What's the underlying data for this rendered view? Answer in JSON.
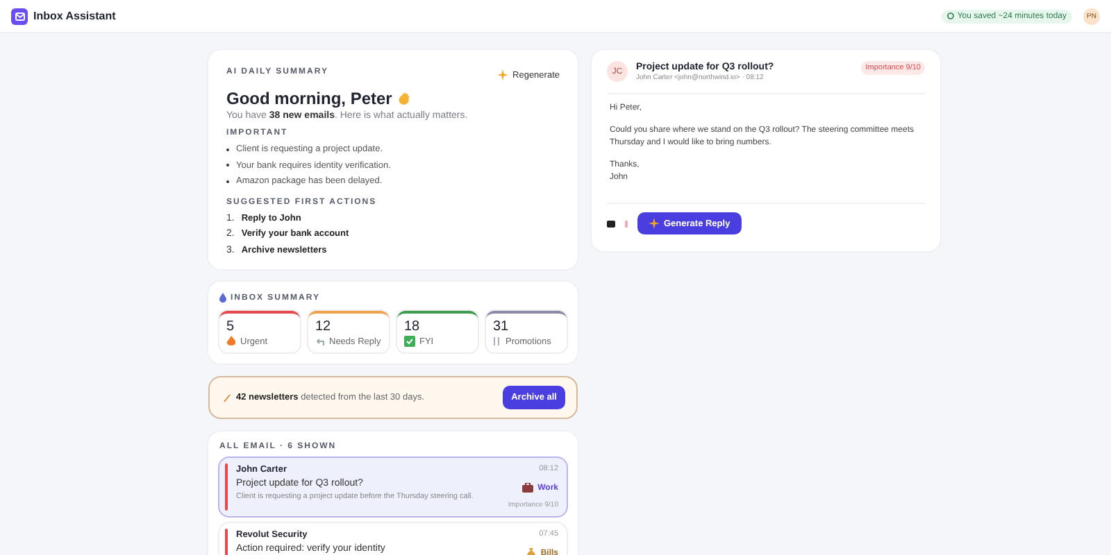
{
  "header": {
    "title": "Inbox Assistant",
    "saved_badge": "You saved ~24 minutes today",
    "avatar_initials": "PN"
  },
  "daily_summary": {
    "label": "AI DAILY SUMMARY",
    "regenerate_button": "Regenerate",
    "greeting": "Good morning, Peter",
    "subtitle": "You have **38 new emails**. Here is what actually matters.",
    "important_label": "IMPORTANT",
    "important": [
      "Client is requesting a project update.",
      "Your bank requires identity verification.",
      "Amazon package has been delayed."
    ],
    "actions_label": "SUGGESTED FIRST ACTIONS",
    "actions": [
      {
        "number": "1.",
        "text": "Reply to John"
      },
      {
        "number": "2.",
        "text": "Verify your bank account"
      },
      {
        "number": "3.",
        "text": "Archive newsletters"
      }
    ]
  },
  "inbox_summary": {
    "label": "INBOX SUMMARY",
    "categories": [
      {
        "kind": "urgent",
        "count": "5",
        "label": "Urgent",
        "color": "#e5484d"
      },
      {
        "kind": "reply",
        "count": "12",
        "label": "Needs Reply",
        "color": "#f0a24b"
      },
      {
        "kind": "fyi",
        "count": "18",
        "label": "FYI",
        "color": "#3f9c4f"
      },
      {
        "kind": "promo",
        "count": "31",
        "label": "Promotions",
        "color": "#8a8aa8"
      }
    ]
  },
  "newsletter_banner": {
    "text": "**42 newsletters** detected from the last 30 days.",
    "button": "Archive all"
  },
  "email_list": {
    "label": "ALL EMAIL · 6 SHOWN",
    "emails": [
      {
        "sender": "John Carter",
        "time": "08:12",
        "subject": "Project update for Q3 rollout?",
        "preview": "Client is requesting a project update before the Thursday steering call.",
        "tag": "Work",
        "kind": "work",
        "importance": "Importance 9/10",
        "selected": true,
        "color": "#e5484d"
      },
      {
        "sender": "Revolut Security",
        "time": "07:45",
        "subject": "Action required: verify your identity",
        "tag": "Bills",
        "kind": "bills",
        "selected": false,
        "color": "#e5484d"
      }
    ]
  },
  "email_detail": {
    "initials": "JC",
    "subject": "Project update for Q3 rollout?",
    "meta": "John Carter <john@northwind.io> · 08:12",
    "importance": "Importance 9/10",
    "body": [
      "Hi Peter,",
      "Could you share where we stand on the Q3 rollout? The steering committee meets Thursday and I would like to bring numbers.",
      "Thanks,\nJohn"
    ],
    "generate_button": "Generate Reply"
  }
}
